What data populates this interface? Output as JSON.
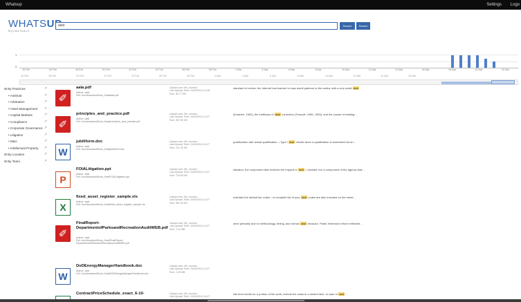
{
  "topbar": {
    "brand": "Whatsup",
    "settings": "Settings",
    "logout": "Logo"
  },
  "logo": {
    "name_pre": "WHATS",
    "name_post": "UP",
    "tagline": "Big Data Search"
  },
  "search": {
    "value": "asst"
  },
  "buttons": {
    "search": "Search",
    "advanced": "Search"
  },
  "timeline": {
    "y_labels": [
      "1",
      "0"
    ],
    "ticks": [
      "16 Feb",
      "16 Feb",
      "18 Feb",
      "20 Feb",
      "22 Feb",
      "24 Feb",
      "26 Feb",
      "28 Feb",
      "2 Mar",
      "4 Mar",
      "6 Mar",
      "8 Mar",
      "10 Mar",
      "12 Mar",
      "14 Mar",
      "16 Mar",
      "18 Mar",
      "20 Mar",
      "22 Mar"
    ],
    "ticks2": [
      "16 Feb",
      "18 Feb",
      "20 Feb",
      "22 Feb",
      "24 Feb",
      "26 Feb",
      "28 Feb",
      "2 Mar",
      "4 Mar",
      "6 Mar",
      "8 Mar",
      "10 Mar",
      "12 Mar",
      "14 Mar",
      "16 Mar"
    ],
    "bars": [
      1,
      1,
      1,
      1,
      0.7,
      0.5
    ]
  },
  "sidebar": {
    "items": [
      {
        "label": "By Practices",
        "sub": false
      },
      {
        "label": "Antitrust",
        "sub": true
      },
      {
        "label": "Arbitration",
        "sub": true
      },
      {
        "label": "Asset Management",
        "sub": true
      },
      {
        "label": "Capital Markets",
        "sub": true
      },
      {
        "label": "Compliance",
        "sub": true
      },
      {
        "label": "Corporate Governance",
        "sub": true
      },
      {
        "label": "Litigation",
        "sub": true
      },
      {
        "label": "M&A",
        "sub": true
      },
      {
        "label": "Intellectual Property",
        "sub": true
      },
      {
        "label": "By Location",
        "sub": false
      },
      {
        "label": "By Team",
        "sub": false
      }
    ]
  },
  "results": [
    {
      "type": "pdf",
      "name": "aala.pdf",
      "meta": "Author: asst\nFull: /srv/docs/asst/Docs_final/aala.pdf",
      "dmeta": "Upload user: file_monitor\nLast Upload Time: 24/03/2014 14:28\nSize: 60.77 KB",
      "snippet_pre": "standard of review: the Internet had learned to map result patterns to the author with a very small ",
      "snippet_hit": "asst",
      "snippet_post": ""
    },
    {
      "type": "pdf",
      "name": "principles_and_practice.pdf",
      "meta": "Author: asst\nFull: /srv/docs/asst/Docs_final/principles_and_practice.pdf",
      "dmeta": "Upload user: file_monitor\nLast Upload Time: 24/03/2014 14:27\nSize: 357.52 KB",
      "snippet_pre": "(Krashen, 1981), the inefficacy of ",
      "snippet_hit": "asst",
      "snippet_post": " correction (Truscott, 1996, 1999), and the 'power of reading..."
    },
    {
      "type": "doc",
      "name": "jubiliform.doc",
      "meta": "Author: asst\nFull: /srv/docs/asst/Docs_final/jubiliform.doc",
      "dmeta": "Upload user: file_monitor\nLast Upload Time: 24/03/2014 14:27\nSize: 211.93 KB",
      "snippet_pre": "qualification with actual qualification. • Type I ",
      "snippet_hit": "asst",
      "snippet_post": " results when a qualification is warranted but an..."
    },
    {
      "type": "ppt",
      "name": "FOIALitigation.ppt",
      "meta": "Author: asst\nFull: /srv/docs/asst/Docs_final/FOIALitigation.ppt",
      "dmeta": "Upload user: file_monitor\nLast Upload Time: 24/03/2014 14:27\nSize: 718.56 KB",
      "snippet_pre": "situation, the component that receives the request in ",
      "snippet_hit": "asst",
      "snippet_post": " • circulate it to a component of the agency that..."
    },
    {
      "type": "xls",
      "name": "fixed_asset_register_sample.xls",
      "meta": "Author: asst\nFull: /srv/docs/asst/Docs_final/fixed_asset_register_sample.xls",
      "dmeta": "Upload user: file_monitor\nLast Upload Time: 24/03/2014 14:27\nSize: 987.04 KB",
      "snippet_pre": "maintain the default tax codes. • A complete list of your ",
      "snippet_hit": "asst",
      "snippet_post": " codes are also included on the sheet..."
    },
    {
      "type": "pdf",
      "name": "FinalReport-DepartmentofParksandRecreationAuditWEB.pdf",
      "meta": "Author: asst\nFull: /srv/docs/asst/Docs_final/FinalReport-DepartmentofParksandRecreationAuditWEB.pdf",
      "dmeta": "Upload user: file_monitor\nLast Upload Time: 24/03/2014 14:27\nSize: 1.24 MB",
      "snippet_pre": "were primarily due to methodology, timing, and human ",
      "snippet_hit": "asst",
      "snippet_post": " because. Parks' extension reform reflected..."
    },
    {
      "type": "doc",
      "name": "DoDEnergyManagerHandbook.doc",
      "meta": "Author: asst\nFull: /srv/docs/asst/Docs_final/DoDEnergyManagerHandbook.doc",
      "dmeta": "Upload user: file_monitor\nLast Upload Time: 24/03/2014 14:27\nSize: 1.39 MB",
      "snippet_pre": "",
      "snippet_hit": "",
      "snippet_post": ""
    },
    {
      "type": "xls",
      "name": "ContractPriceSchedule_exact_6-10-",
      "meta": "",
      "dmeta": "Upload user: file_monitor\nLast Upload Time: 24/03/2014 14:27",
      "snippet_pre": "line item needs for a portion of the work, include the costs in a nested item. In case of ",
      "snippet_hit": "asst",
      "snippet_post": "..."
    }
  ]
}
